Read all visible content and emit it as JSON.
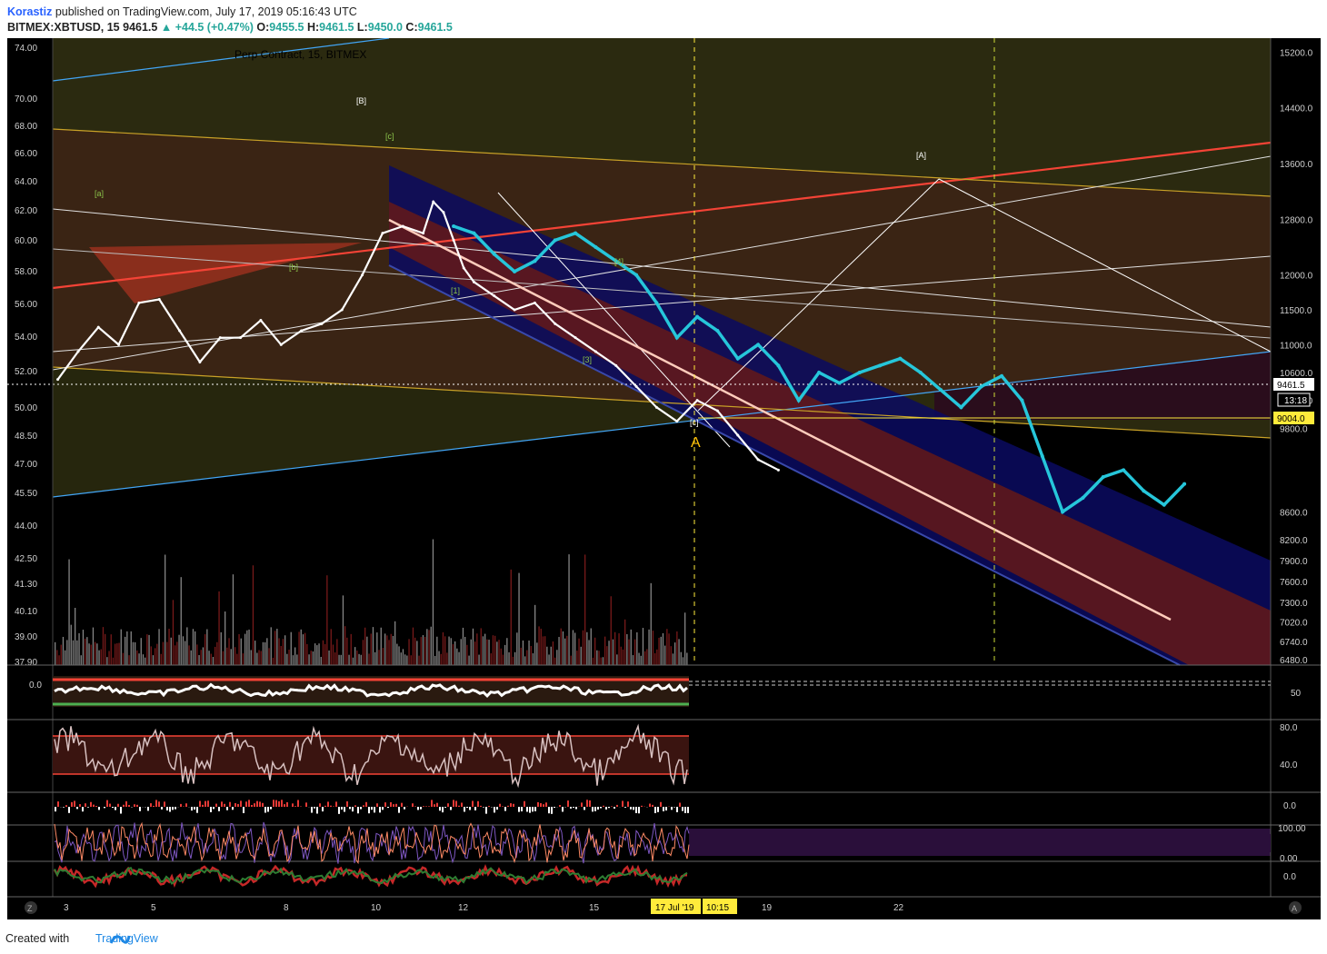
{
  "header": {
    "author": "Korastiz",
    "published_text": "published on TradingView.com, July 17, 2019 05:16:43 UTC",
    "symbol": "BITMEX:XBTUSD, 15",
    "last": "9461.5",
    "change": "+44.5 (+0.47%)",
    "o_label": "O:",
    "o_value": "9455.5",
    "h_label": "H:",
    "h_value": "9461.5",
    "l_label": "L:",
    "l_value": "9450.0",
    "c_label": "C:",
    "c_value": "9461.5"
  },
  "chart_overlay_subtitle": "Perp Contract, 15, BITMEX",
  "footer": {
    "created_with": "Created with",
    "brand": "TradingView"
  },
  "colors": {
    "background": "#000000",
    "price_candles": "#ffffff",
    "forecast_candles": "#26c6da",
    "red_line": "#f44336",
    "yellow_line": "#ffd54f",
    "blue_line": "#2196f3",
    "price_tag": "#ffffff",
    "level_tag": "#ffeb3b"
  },
  "chart_data": {
    "type": "line",
    "title": "",
    "x_tick_labels": [
      "3",
      "5",
      "8",
      "10",
      "12",
      "15",
      "17 Jul '19",
      "10:15",
      "19",
      "22"
    ],
    "right_axis_labels": [
      "15200.0",
      "14400.0",
      "13600.0",
      "12800.0",
      "12000.0",
      "11500.0",
      "11000.0",
      "10600.0",
      "10200.0",
      "9800.0",
      "9461.5",
      "13:18",
      "9004.0",
      "8600.0",
      "8200.0",
      "7900.0",
      "7600.0",
      "7300.0",
      "7020.0",
      "6740.0",
      "6480.0"
    ],
    "left_axis_labels": [
      "74.00",
      "70.00",
      "68.00",
      "66.00",
      "64.00",
      "62.00",
      "60.00",
      "58.00",
      "56.00",
      "54.00",
      "52.00",
      "50.00",
      "48.50",
      "47.00",
      "45.50",
      "44.00",
      "42.50",
      "41.30",
      "40.10",
      "39.00",
      "37.90"
    ],
    "last_price": 9461.5,
    "level_tag": 9004.0,
    "wave_labels": [
      "[B]",
      "[c]",
      "[a]",
      "[b]",
      "[1]",
      "[3]",
      "[4]",
      "[c]",
      "[A]",
      "A"
    ],
    "price_series": {
      "name": "",
      "x": [
        2.8,
        3.2,
        3.6,
        4.0,
        4.4,
        4.8,
        5.2,
        5.6,
        6.0,
        6.4,
        6.8,
        7.2,
        7.6,
        8.0,
        8.4,
        8.8,
        9.2,
        9.6,
        10.0,
        10.2,
        10.4,
        10.6,
        10.8,
        11.0,
        11.4,
        11.8,
        12.2,
        12.6,
        13.0,
        13.4,
        13.8,
        14.2,
        14.6,
        15.0,
        15.4,
        15.8,
        16.2,
        16.6,
        17.0
      ],
      "y": [
        10500,
        10900,
        11250,
        11000,
        11600,
        11650,
        11200,
        10750,
        11100,
        11100,
        11350,
        11000,
        11200,
        11300,
        11500,
        12000,
        12600,
        12700,
        12600,
        13050,
        12900,
        12500,
        12100,
        11900,
        11700,
        11500,
        11600,
        11300,
        11100,
        10900,
        10700,
        10400,
        10100,
        9900,
        10200,
        10050,
        9700,
        9350,
        9200
      ]
    },
    "forecast_series": {
      "name": "",
      "x": [
        10.6,
        11.0,
        11.4,
        11.8,
        12.2,
        12.6,
        13.0,
        13.4,
        13.8,
        14.2,
        14.6,
        15.0,
        15.4,
        15.8,
        16.2,
        16.6,
        17.0,
        17.4,
        17.8,
        18.2,
        18.6,
        19.0,
        19.4,
        19.8,
        20.2,
        20.6,
        21.0,
        21.4,
        21.8,
        22.2,
        22.6,
        23.0,
        23.4,
        23.8,
        24.2,
        24.6,
        25.0
      ],
      "y": [
        12700,
        12600,
        12300,
        12050,
        12200,
        12500,
        12600,
        12400,
        12200,
        12000,
        11600,
        11100,
        11400,
        11200,
        10800,
        11000,
        10700,
        10200,
        10600,
        10450,
        10600,
        10700,
        10800,
        10600,
        10350,
        10100,
        10400,
        10550,
        10200,
        9400,
        8600,
        8800,
        9100,
        9200,
        8900,
        8700,
        9000
      ]
    },
    "ylim": [
      6400,
      15400
    ],
    "xlim": [
      2.7,
      26.7
    ]
  }
}
